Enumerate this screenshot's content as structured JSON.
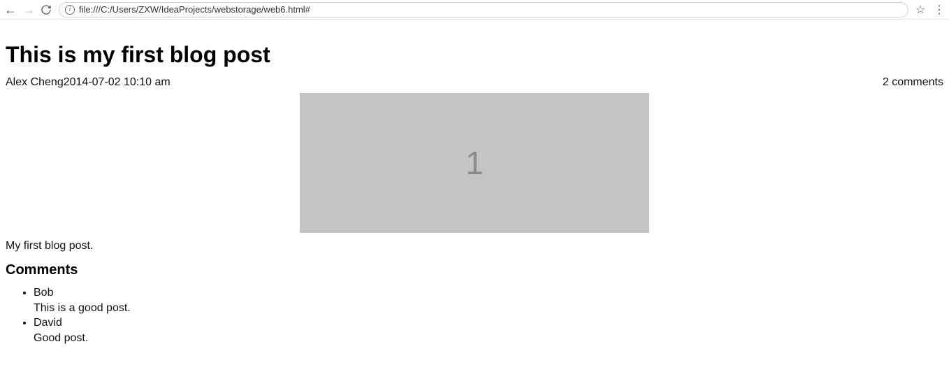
{
  "browser": {
    "url": "file:///C:/Users/ZXW/IdeaProjects/webstorage/web6.html#"
  },
  "post": {
    "title": "This is my first blog post",
    "author": "Alex Cheng",
    "timestamp": "2014-07-02 10:10 am",
    "comments_count_label": "2 comments",
    "image_placeholder_text": "1",
    "body": "My first blog post."
  },
  "comments": {
    "heading": "Comments",
    "items": [
      {
        "author": "Bob",
        "text": "This is a good post."
      },
      {
        "author": "David",
        "text": "Good post."
      }
    ]
  }
}
